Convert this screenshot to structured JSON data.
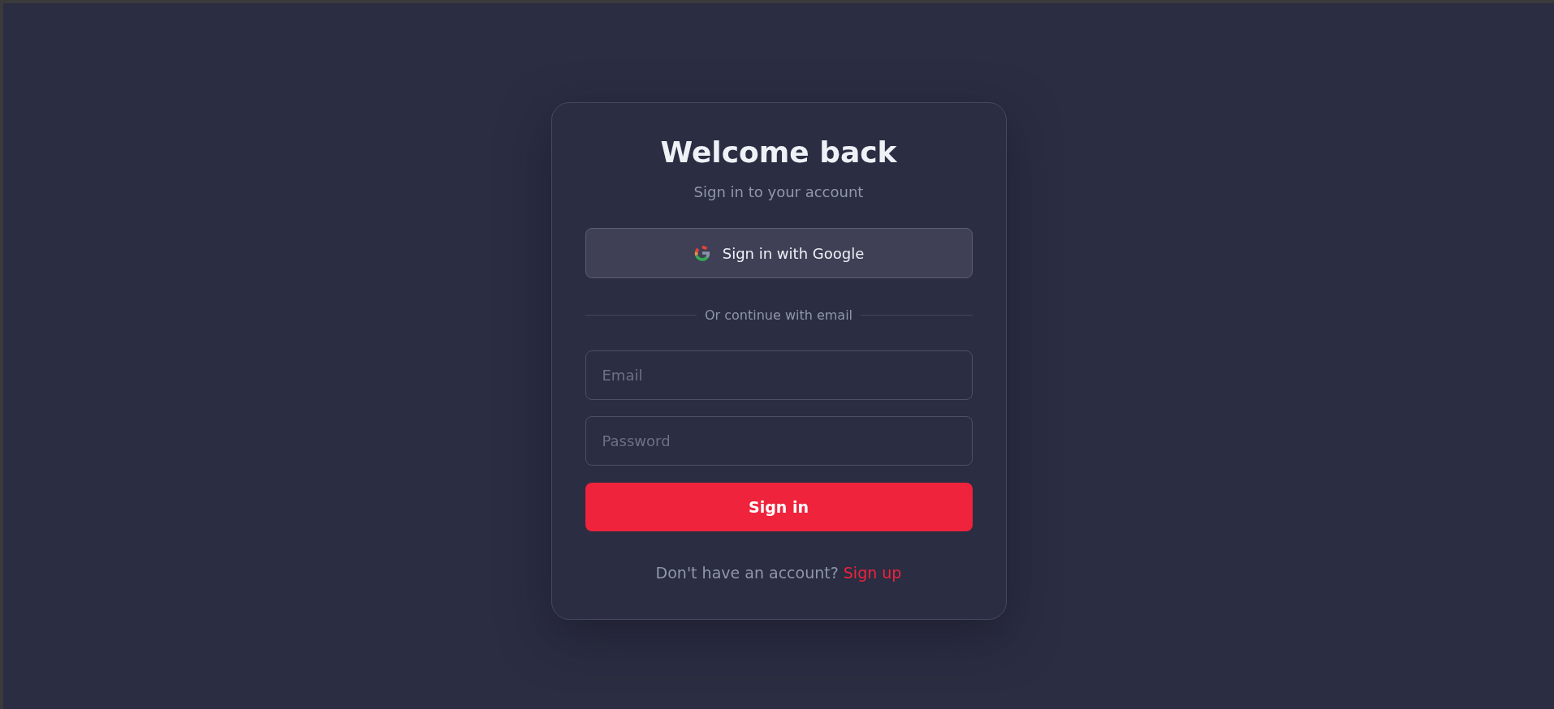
{
  "title": "Welcome back",
  "subtitle": "Sign in to your account",
  "google_button": {
    "label": "Sign in with Google"
  },
  "divider": "Or continue with email",
  "fields": [
    {
      "placeholder": "Email"
    },
    {
      "placeholder": "Password"
    }
  ],
  "submit_button": {
    "label": "Sign in"
  },
  "footer": {
    "text": "Don't have an account?",
    "link": "Sign up"
  }
}
